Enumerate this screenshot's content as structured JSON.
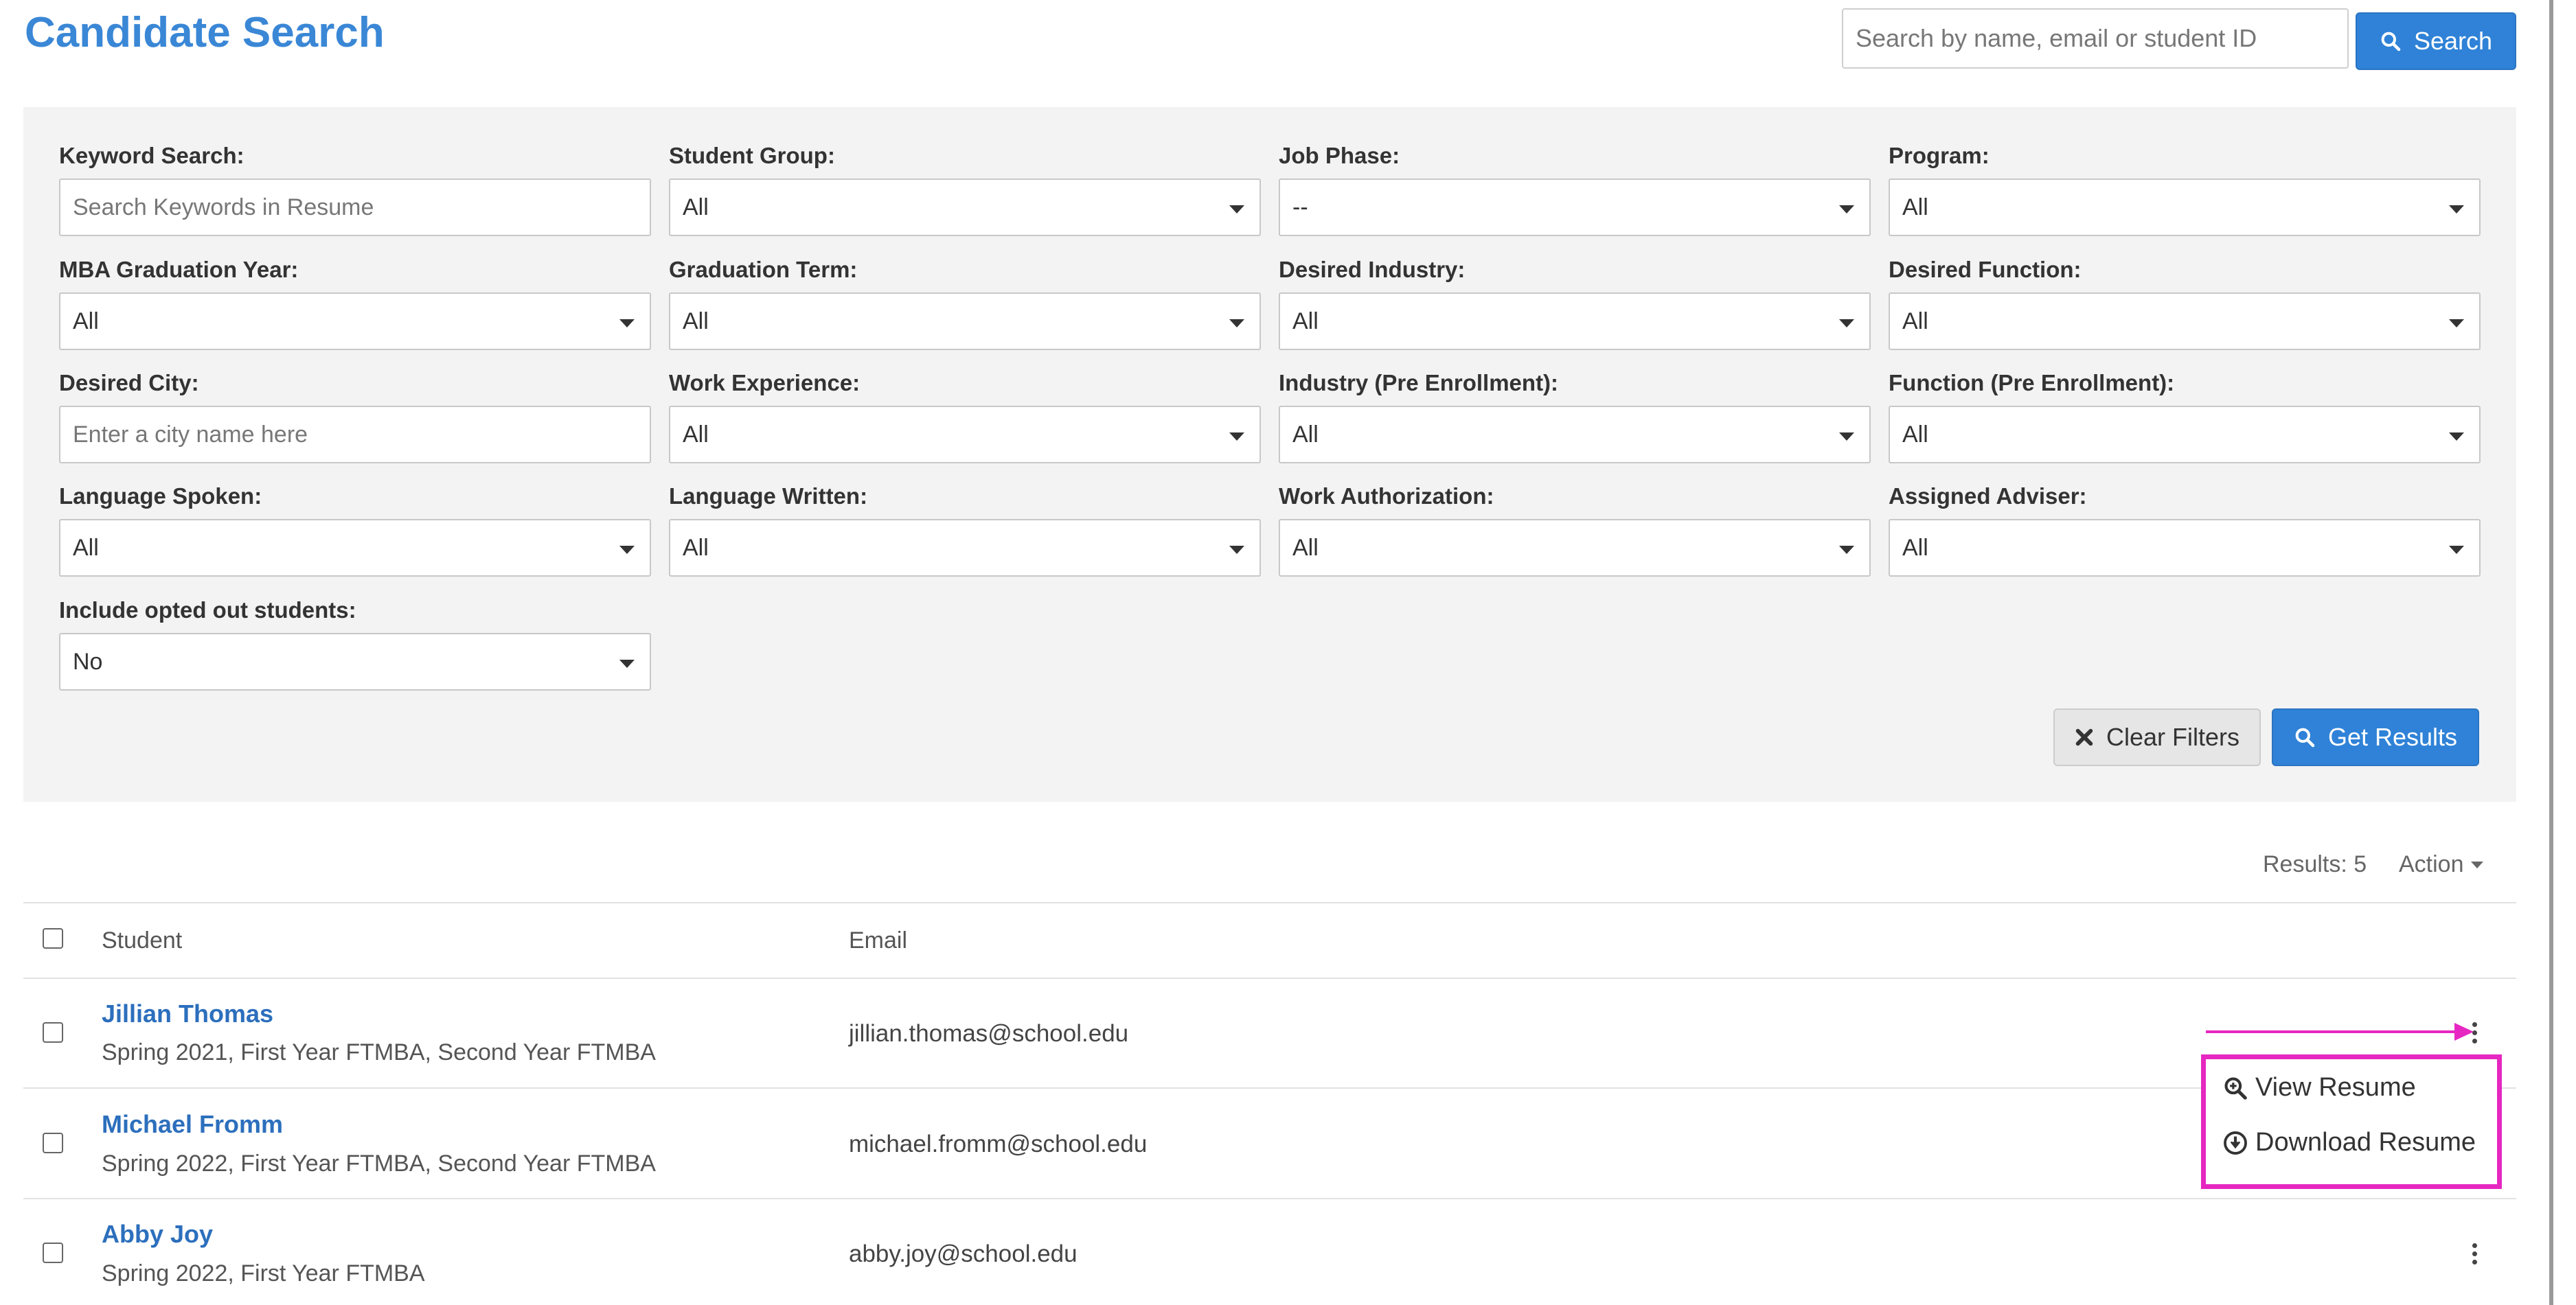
{
  "header": {
    "title": "Candidate Search",
    "search_placeholder": "Search by name, email or student ID",
    "search_button": "Search"
  },
  "filters": {
    "keyword": {
      "label": "Keyword Search:",
      "placeholder": "Search Keywords in Resume"
    },
    "student_group": {
      "label": "Student Group:",
      "value": "All"
    },
    "job_phase": {
      "label": "Job Phase:",
      "value": "--"
    },
    "program": {
      "label": "Program:",
      "value": "All"
    },
    "mba_graduation_year": {
      "label": "MBA Graduation Year:",
      "value": "All"
    },
    "graduation_term": {
      "label": "Graduation Term:",
      "value": "All"
    },
    "desired_industry": {
      "label": "Desired Industry:",
      "value": "All"
    },
    "desired_function": {
      "label": "Desired Function:",
      "value": "All"
    },
    "desired_city": {
      "label": "Desired City:",
      "placeholder": "Enter a city name here"
    },
    "work_experience": {
      "label": "Work Experience:",
      "value": "All"
    },
    "industry_pre": {
      "label": "Industry (Pre Enrollment):",
      "value": "All"
    },
    "function_pre": {
      "label": "Function (Pre Enrollment):",
      "value": "All"
    },
    "language_spoken": {
      "label": "Language Spoken:",
      "value": "All"
    },
    "language_written": {
      "label": "Language Written:",
      "value": "All"
    },
    "work_authorization": {
      "label": "Work Authorization:",
      "value": "All"
    },
    "assigned_adviser": {
      "label": "Assigned Adviser:",
      "value": "All"
    },
    "include_opted_out": {
      "label": "Include opted out students:",
      "value": "No"
    },
    "clear_button": "Clear Filters",
    "get_results_button": "Get Results"
  },
  "results": {
    "count_text": "Results: 5",
    "action_label": "Action",
    "columns": {
      "student": "Student",
      "email": "Email"
    },
    "rows": [
      {
        "name": "Jillian Thomas",
        "details": "Spring 2021, First Year FTMBA, Second Year FTMBA",
        "email": "jillian.thomas@school.edu"
      },
      {
        "name": "Michael Fromm",
        "details": "Spring 2022, First Year FTMBA, Second Year FTMBA",
        "email": "michael.fromm@school.edu"
      },
      {
        "name": "Abby Joy",
        "details": "Spring 2022, First Year FTMBA",
        "email": "abby.joy@school.edu"
      }
    ]
  },
  "row_menu": {
    "view_resume": "View Resume",
    "download_resume": "Download Resume"
  },
  "icons": {
    "search": "search-icon",
    "clear": "x-icon",
    "view": "zoom-in-icon",
    "download": "download-circle-icon",
    "row_menu": "kebab-icon"
  },
  "colors": {
    "accent": "#3a87d6",
    "primary_button": "#2f82d7",
    "link": "#2c6fbd",
    "annotation": "#e627c1",
    "panel_bg": "#f3f3f3"
  }
}
